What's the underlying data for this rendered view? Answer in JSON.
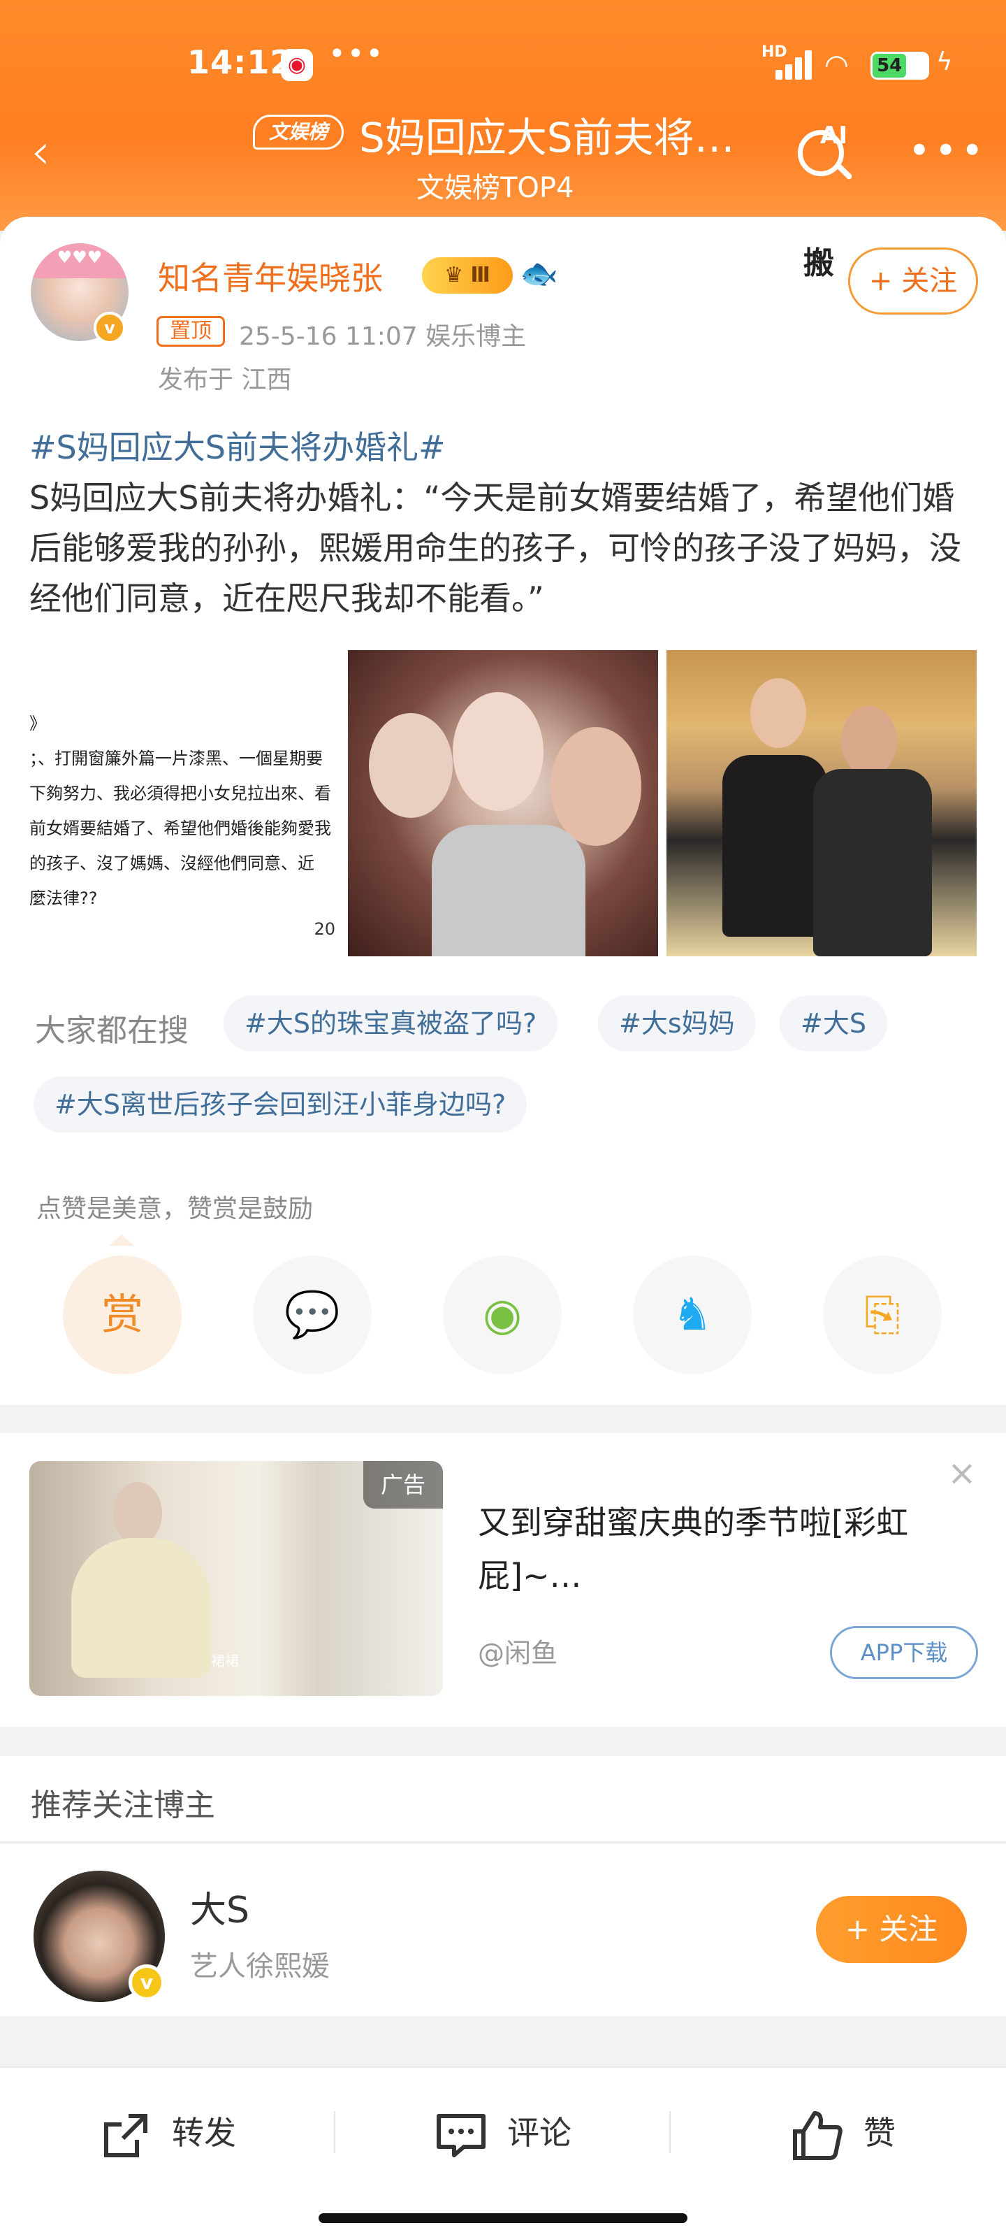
{
  "status_bar": {
    "time": "14:12",
    "more": "•••",
    "network": "HD",
    "battery": "54"
  },
  "header": {
    "back_icon": "back-chevron-icon",
    "tag": "文娱榜",
    "title": "S妈回应大S前夫将…",
    "subtitle": "文娱榜TOP4",
    "ai_label": "AI",
    "more_label": "•••"
  },
  "post": {
    "author": "知名青年娱晓张",
    "level_badge": "Ⅲ",
    "pinned": "置顶",
    "meta": "25-5-16 11:07   娱乐博主",
    "location": "发布于 江西",
    "follow": "+ 关注",
    "sticker_text": "搬",
    "hashtag": "#S妈回应大S前夫将办婚礼#",
    "body": "S妈回应大S前夫将办婚礼：“今天是前女婿要结婚了，希望他们婚后能够爱我的孙孙，熙媛用命生的孩子，可怜的孩子没了妈妈，没经他们同意，近在咫尺我却不能看。”",
    "image1_lines": [
      "》",
      "；、打開窗簾外篇一片漆黑、一個星期要",
      "下夠努力、我必須得把小女兒拉出來、看",
      "前女婿要結婚了、希望他們婚後能夠愛我",
      "的孩子、沒了媽媽、沒經他們同意、近",
      "麼法律??"
    ],
    "image1_page": "20"
  },
  "hot_search": {
    "label": "大家都在搜",
    "items": [
      "#大S的珠宝真被盗了吗?",
      "#大s妈妈",
      "#大S",
      "#大S离世后孩子会回到汪小菲身边吗?"
    ]
  },
  "reward": {
    "hint": "点赞是美意，赞赏是鼓励",
    "reward_label": "赏",
    "share_icons": [
      "wechat-icon",
      "moments-icon",
      "qq-icon",
      "save-image-icon"
    ]
  },
  "ad": {
    "tag": "广告",
    "title": "又到穿甜蜜庆典的季节啦[彩虹屁]~…",
    "source": "@闲鱼",
    "button": "APP下载",
    "caption": "裙裙"
  },
  "recommend": {
    "title": "推荐关注博主",
    "name": "大S",
    "desc": "艺人徐熙媛",
    "follow": "+ 关注"
  },
  "bottom_bar": {
    "repost": "转发",
    "comment": "评论",
    "like": "赞"
  },
  "colors": {
    "brand_orange": "#ff7f22",
    "link_blue": "#406e98",
    "name_orange": "#f06f1c"
  }
}
